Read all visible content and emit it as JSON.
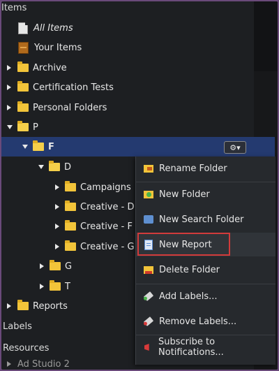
{
  "tree": {
    "items_header": "Items",
    "all_items": "All Items",
    "your_items": "Your Items",
    "archive": "Archive",
    "certification_tests": "Certification Tests",
    "personal_folders": "Personal Folders",
    "p": "P",
    "f": "F",
    "d": "D",
    "campaigns": "Campaigns",
    "creative_d": "Creative - D",
    "creative_f": "Creative - F",
    "creative_g": "Creative - G",
    "g": "G",
    "t": "T",
    "reports": "Reports",
    "labels_header": "Labels",
    "resources_header": "Resources",
    "ad_studio": "Ad Studio 2"
  },
  "gear_button": {
    "label": "⚙▾"
  },
  "context_menu": {
    "rename_folder": "Rename Folder",
    "new_folder": "New Folder",
    "new_search_folder": "New Search Folder",
    "new_report": "New Report",
    "delete_folder": "Delete Folder",
    "add_labels": "Add Labels...",
    "remove_labels": "Remove Labels...",
    "subscribe": "Subscribe to Notifications..."
  },
  "colors": {
    "selection": "#243a70",
    "folder": "#f2c43a",
    "highlight_box": "#d23b3b"
  },
  "icons": [
    "document-icon",
    "cabinet-icon",
    "folder-icon",
    "gear-icon",
    "rename-folder-icon",
    "new-folder-icon",
    "search-folder-icon",
    "report-icon",
    "delete-folder-icon",
    "add-label-icon",
    "remove-label-icon",
    "subscribe-icon"
  ]
}
